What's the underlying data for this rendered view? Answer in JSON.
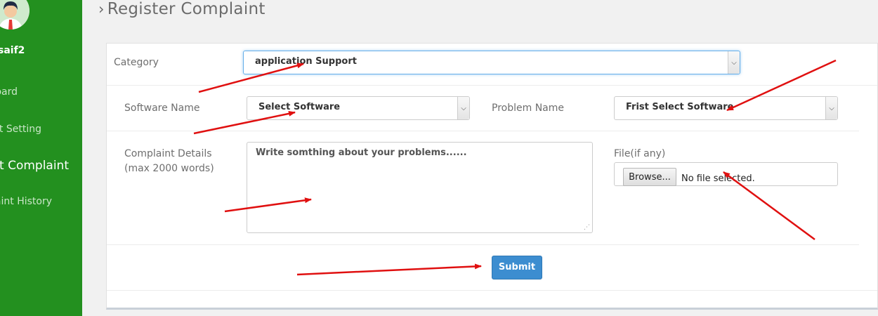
{
  "sidebar": {
    "user_name": "saif2",
    "items": [
      {
        "label": "oard"
      },
      {
        "label": "t Setting"
      },
      {
        "label": "it Complaint"
      },
      {
        "label": "aint History"
      }
    ]
  },
  "page": {
    "title": "Register Complaint"
  },
  "form": {
    "category_label": "Category",
    "category_value": "application Support",
    "software_label": "Software Name",
    "software_value": "Select Software",
    "problem_label": "Problem Name",
    "problem_value": "Frist Select Software",
    "details_label_line1": "Complaint Details",
    "details_label_line2": "(max 2000 words)",
    "details_placeholder": "Write somthing about your problems......",
    "file_label": "File(if any)",
    "browse_label": "Browse...",
    "file_status": "No file selected.",
    "submit_label": "Submit"
  },
  "colors": {
    "sidebar": "#23901f",
    "submit": "#3c8dd0",
    "annotation": "#e01010"
  }
}
